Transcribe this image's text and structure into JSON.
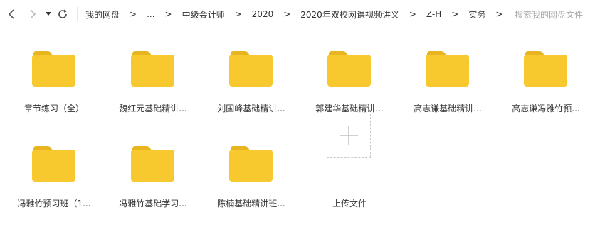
{
  "toolbar": {
    "back_icon": "chevron-left-icon",
    "forward_icon": "chevron-right-icon",
    "history_icon": "caret-down-icon",
    "refresh_icon": "refresh-icon"
  },
  "breadcrumb": {
    "items": [
      "我的网盘",
      "...",
      "中级会计师",
      "2020",
      "2020年双校网课视频讲义",
      "Z-H",
      "实务"
    ],
    "separator": ">"
  },
  "search": {
    "placeholder": "搜索我的网盘文件"
  },
  "folders": [
    {
      "name": "章节练习（全）"
    },
    {
      "name": "魏红元基础精讲..."
    },
    {
      "name": "刘国峰基础精讲..."
    },
    {
      "name": "郭建华基础精讲..."
    },
    {
      "name": "高志谦基础精讲..."
    },
    {
      "name": "高志谦冯雅竹预..."
    },
    {
      "name": "冯雅竹预习班（1..."
    },
    {
      "name": "冯雅竹基础学习..."
    },
    {
      "name": "陈楠基础精讲班..."
    }
  ],
  "upload": {
    "label": "上传文件",
    "icon": "plus-icon"
  },
  "colors": {
    "folder_body": "#F7C92F",
    "folder_tab": "#E8B41F"
  }
}
